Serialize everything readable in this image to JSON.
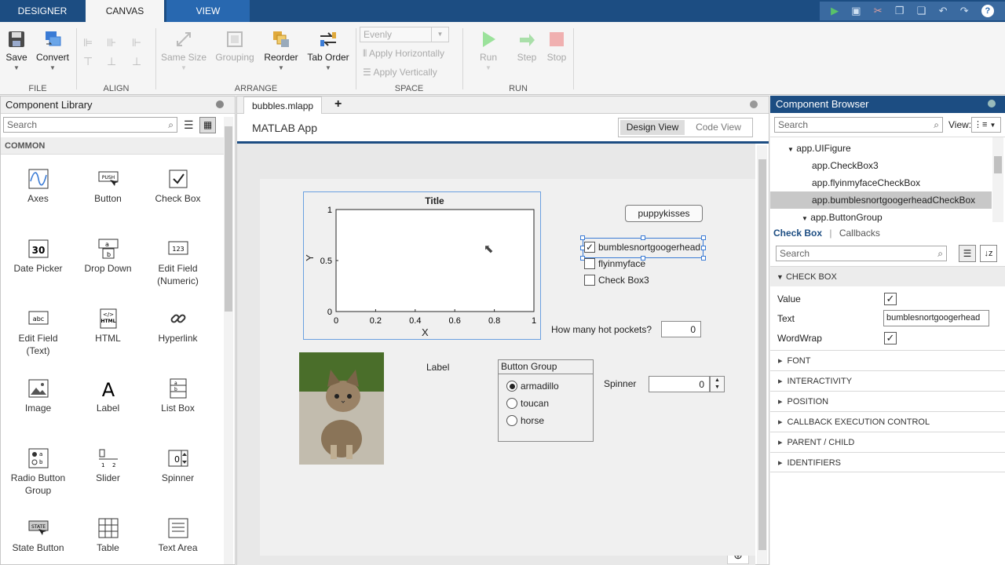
{
  "tabs": [
    {
      "label": "DESIGNER"
    },
    {
      "label": "CANVAS"
    },
    {
      "label": "VIEW"
    }
  ],
  "ribbon": {
    "file": {
      "save": "Save",
      "convert": "Convert",
      "group": "FILE"
    },
    "align": {
      "group": "ALIGN"
    },
    "arrange": {
      "same_size": "Same Size",
      "grouping": "Grouping",
      "reorder": "Reorder",
      "tab_order": "Tab Order",
      "group": "ARRANGE"
    },
    "space": {
      "evenly": "Evenly",
      "apply_h": "Apply Horizontally",
      "apply_v": "Apply Vertically",
      "group": "SPACE"
    },
    "run": {
      "run": "Run",
      "step": "Step",
      "stop": "Stop",
      "group": "RUN"
    }
  },
  "library": {
    "title": "Component Library",
    "search_placeholder": "Search",
    "section": "COMMON",
    "items": [
      {
        "label": "Axes"
      },
      {
        "label": "Button"
      },
      {
        "label": "Check Box"
      },
      {
        "label": "Date Picker"
      },
      {
        "label": "Drop Down"
      },
      {
        "label": "Edit Field\n(Numeric)"
      },
      {
        "label": "Edit Field\n(Text)"
      },
      {
        "label": "HTML"
      },
      {
        "label": "Hyperlink"
      },
      {
        "label": "Image"
      },
      {
        "label": "Label"
      },
      {
        "label": "List Box"
      },
      {
        "label": "Radio Button\nGroup"
      },
      {
        "label": "Slider"
      },
      {
        "label": "Spinner"
      },
      {
        "label": "State Button"
      },
      {
        "label": "Table"
      },
      {
        "label": "Text Area"
      }
    ]
  },
  "editor": {
    "file_tab": "bubbles.mlapp",
    "app_title": "MATLAB App",
    "design_view": "Design View",
    "code_view": "Code View"
  },
  "app": {
    "axes": {
      "title": "Title",
      "xlabel": "X",
      "ylabel": "Y",
      "xticks": [
        "0",
        "0.2",
        "0.4",
        "0.6",
        "0.8",
        "1"
      ],
      "yticks": [
        "0",
        "0.5",
        "1"
      ]
    },
    "button": "puppykisses",
    "checkboxes": [
      {
        "label": "bumblesnortgoogerhead",
        "checked": "✓"
      },
      {
        "label": "flyinmyface",
        "checked": ""
      },
      {
        "label": "Check Box3",
        "checked": ""
      }
    ],
    "numeric_label": "How many hot pockets?",
    "numeric_value": "0",
    "label": "Label",
    "button_group": {
      "title": "Button Group",
      "options": [
        "armadillo",
        "toucan",
        "horse"
      ]
    },
    "spinner_label": "Spinner",
    "spinner_value": "0"
  },
  "browser": {
    "title": "Component Browser",
    "search_placeholder": "Search",
    "view_label": "View:",
    "tree": [
      "app.UIFigure",
      "app.CheckBox3",
      "app.flyinmyfaceCheckBox",
      "app.bumblesnortgoogerheadCheckBox",
      "app.ButtonGroup"
    ],
    "inspector_tab": "Check Box",
    "callbacks_tab": "Callbacks",
    "prop_search_placeholder": "Search",
    "section_checkbox": "CHECK BOX",
    "props": {
      "value_label": "Value",
      "text_label": "Text",
      "text_value": "bumblesnortgoogerhead",
      "wordwrap_label": "WordWrap"
    },
    "sections": [
      "FONT",
      "INTERACTIVITY",
      "POSITION",
      "CALLBACK EXECUTION CONTROL",
      "PARENT / CHILD",
      "IDENTIFIERS"
    ]
  }
}
